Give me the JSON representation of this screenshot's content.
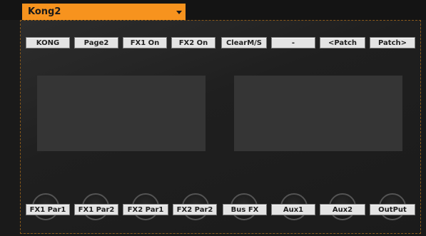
{
  "preset": {
    "name": "Kong2"
  },
  "top_buttons": [
    "KONG",
    "Page2",
    "FX1 On",
    "FX2 On",
    "ClearM/S",
    "-",
    "<Patch",
    "Patch>"
  ],
  "knob_labels": [
    "FX1 Par1",
    "FX1 Par2",
    "FX2 Par1",
    "FX2 Par2",
    "Bus FX",
    "Aux1",
    "Aux2",
    "OutPut"
  ],
  "icons": {
    "preset_dropdown": "chevron-down-icon"
  },
  "colors": {
    "accent": "#f7931e",
    "button": "#e4e4e4",
    "screen": "#353535"
  }
}
